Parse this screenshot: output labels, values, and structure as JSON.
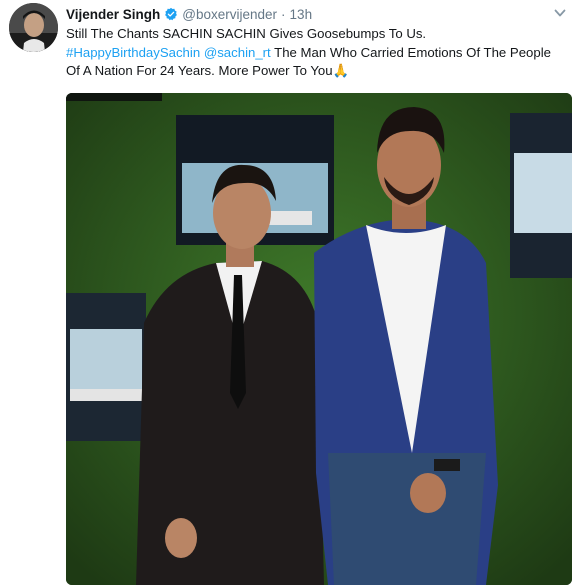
{
  "tweet": {
    "author_name": "Vijender Singh",
    "handle": "@boxervijender",
    "separator": "·",
    "timestamp": "13h",
    "line1": "Still The Chants SACHIN SACHIN Gives Goosebumps To Us.",
    "hashtag": "#HappyBirthdaySachin",
    "mention": "@sachin_rt",
    "line2_rest": " The Man Who Carried Emotions Of The People",
    "line3": "Of A Nation For 24 Years. More Power To You",
    "emoji": "🙏",
    "photo_subject": "two-men-posing-photo"
  },
  "colors": {
    "link": "#1da1f2",
    "secondary_text": "#657786",
    "verified": "#1da1f2",
    "photo_background": "#2e5a1f"
  }
}
